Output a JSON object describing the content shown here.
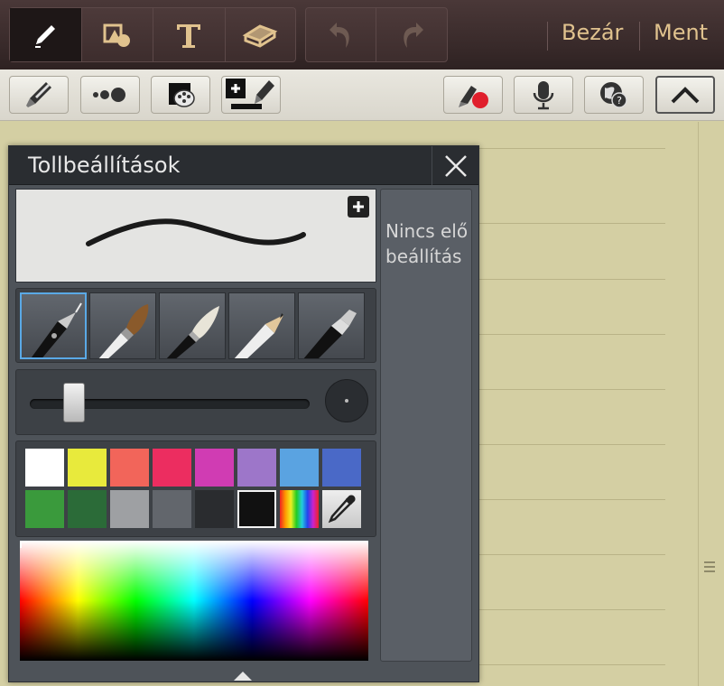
{
  "toolbar": {
    "modes": [
      {
        "icon": "pen-icon",
        "active": true
      },
      {
        "icon": "shape-icon",
        "active": false
      },
      {
        "icon": "text-icon",
        "active": false
      },
      {
        "icon": "eraser-icon",
        "active": false
      }
    ],
    "undo_icon": "undo-icon",
    "redo_icon": "redo-icon",
    "close_label": "Bezár",
    "save_label": "Ment"
  },
  "toolbar2": {
    "items": [
      "pen-type-icon",
      "pen-size-icon",
      "pen-color-icon",
      "add-preset-icon",
      "record-icon",
      "microphone-icon",
      "web-search-icon",
      "collapse-icon"
    ]
  },
  "pen_settings": {
    "title": "Tollbeállítások",
    "presets_empty_text": "Nincs előbeállítás",
    "pen_types": [
      "fountain-pen",
      "brush",
      "calligraphy-brush",
      "pencil",
      "marker"
    ],
    "selected_pen_index": 0,
    "size_level": 0.12,
    "swatches": [
      {
        "color": "#ffffff"
      },
      {
        "color": "#e8ea3c"
      },
      {
        "color": "#f2655a"
      },
      {
        "color": "#ec2d60"
      },
      {
        "color": "#d03cb3"
      },
      {
        "color": "#9d76c9"
      },
      {
        "color": "#5aa3e1"
      },
      {
        "color": "#4a69c7"
      },
      {
        "color": "#3a9a3c"
      },
      {
        "color": "#2b6b38"
      },
      {
        "color": "#9ea0a3"
      },
      {
        "color": "#62666c"
      },
      {
        "color": "#2a2c2f"
      },
      {
        "color": "#111111",
        "selected": true
      },
      {
        "color": "rainbow"
      },
      {
        "color": "eyedropper"
      }
    ]
  }
}
